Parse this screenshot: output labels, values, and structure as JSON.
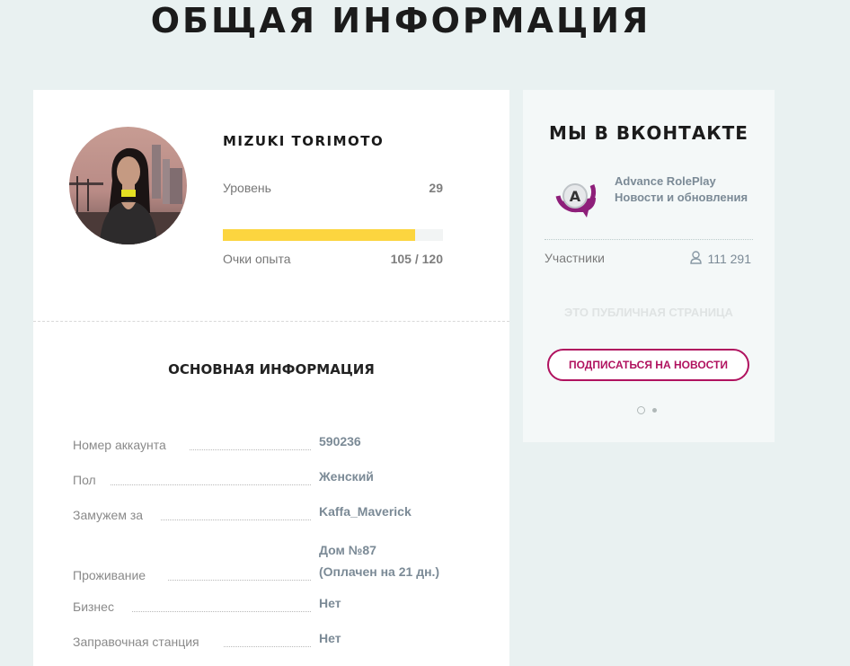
{
  "page_title": "ОБЩАЯ ИНФОРМАЦИЯ",
  "profile": {
    "name": "MIZUKI TORIMOTO",
    "level_label": "Уровень",
    "level_value": "29",
    "xp_label": "Очки опыта",
    "xp_value": "105 / 120",
    "xp_progress": 0.875
  },
  "basic_info": {
    "title": "ОСНОВНАЯ ИНФОРМАЦИЯ",
    "rows": [
      {
        "label": "Номер аккаунта",
        "value": "590236"
      },
      {
        "label": "Пол",
        "value": "Женский"
      },
      {
        "label": "Замужем за",
        "value": "Kaffa_Maverick"
      },
      {
        "label": "Проживание",
        "value": "Дом №87",
        "value2": "(Оплачен на 21 дн.)"
      },
      {
        "label": "Бизнес",
        "value": "Нет"
      },
      {
        "label": "Заправочная станция",
        "value": "Нет"
      }
    ]
  },
  "vk": {
    "title": "МЫ В ВКОНТАКТЕ",
    "group_name": "Advance RolePlay",
    "group_subtitle": "Новости и обновления",
    "members_label": "Участники",
    "members_count": "111 291",
    "public_text": "ЭТО ПУБЛИЧНАЯ СТРАНИЦА",
    "subscribe_label": "ПОДПИСАТЬСЯ НА НОВОСТИ",
    "logo_letter": "A"
  },
  "colors": {
    "xp_bar": "#fcd53f",
    "accent": "#b0125f",
    "background": "#e9f1f1"
  }
}
